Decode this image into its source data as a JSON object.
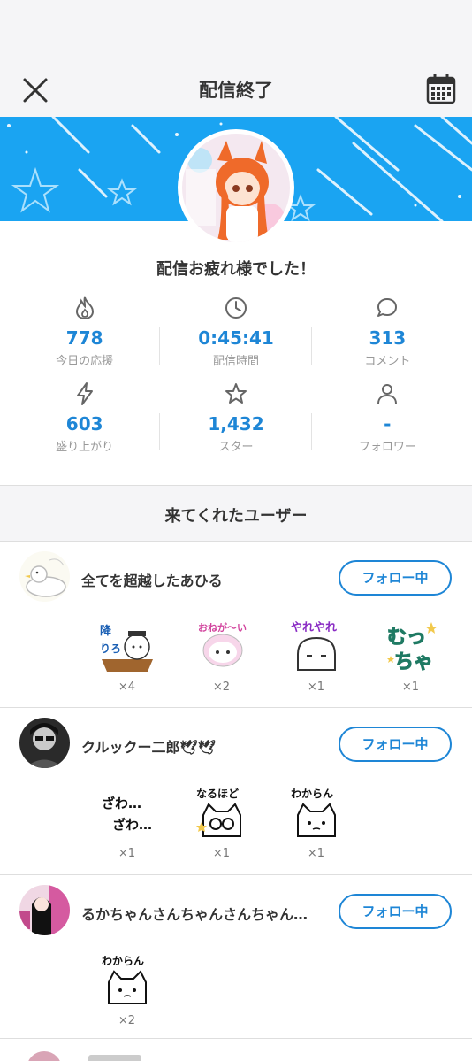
{
  "header": {
    "title": "配信終了"
  },
  "thanks": "配信お疲れ様でした！",
  "stats": [
    {
      "icon": "flame-icon",
      "value": "778",
      "label": "今日の応援"
    },
    {
      "icon": "clock-icon",
      "value": "0:45:41",
      "label": "配信時間"
    },
    {
      "icon": "comment-icon",
      "value": "313",
      "label": "コメント"
    },
    {
      "icon": "lightning-icon",
      "value": "603",
      "label": "盛り上がり"
    },
    {
      "icon": "star-icon",
      "value": "1,432",
      "label": "スター"
    },
    {
      "icon": "person-icon",
      "value": "-",
      "label": "フォロワー"
    }
  ],
  "visitors_title": "来てくれたユーザー",
  "users": [
    {
      "name": "全てを超越したあひる",
      "follow_label": "フォロー中",
      "stamps": [
        {
          "text": "降りろ…",
          "count": "×4"
        },
        {
          "text": "おねがい",
          "count": "×2"
        },
        {
          "text": "やれやれ",
          "count": "×1"
        },
        {
          "text": "むっちゃ",
          "count": "×1"
        }
      ]
    },
    {
      "name": "クルックー二郎🕊🕊",
      "follow_label": "フォロー中",
      "stamps": [
        {
          "text": "ざわ…ざわ…",
          "count": "×1"
        },
        {
          "text": "なるほど",
          "count": "×1"
        },
        {
          "text": "わからん",
          "count": "×1"
        }
      ]
    },
    {
      "name": "るかちゃんさんちゃんさんちゃん…",
      "follow_label": "フォロー中",
      "stamps": [
        {
          "text": "わからん",
          "count": "×2"
        }
      ]
    }
  ]
}
